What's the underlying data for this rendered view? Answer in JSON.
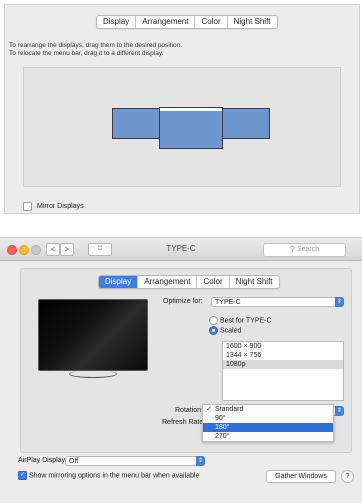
{
  "top_panel": {
    "tabs": [
      "Display",
      "Arrangement",
      "Color",
      "Night Shift"
    ],
    "help_line1": "To rearrange the displays, drag them to the desired position.",
    "help_line2": "To relocate the menu bar, drag it to a different display.",
    "mirror_label": "Mirror Displays",
    "mirror_checked": false
  },
  "window": {
    "title": "TYPE-C",
    "search_placeholder": "Search",
    "back_symbol": "<",
    "forward_symbol": ">",
    "grid_symbol": "⁞⁞⁞",
    "tabs": [
      "Display",
      "Arrangement",
      "Color",
      "Night Shift"
    ],
    "selected_tab": "Display",
    "optimize_label": "Optimize for:",
    "optimize_value": "TYPE-C",
    "best_for_label": "Best for TYPE-C",
    "scaled_label": "Scaled",
    "resolutions": [
      "1600 × 900",
      "1344 × 756",
      "1080p"
    ],
    "selected_resolution": "1080p",
    "rotation_label": "Rotation",
    "refresh_label": "Refresh Rate",
    "rotation_options": [
      "Standard",
      "90°",
      "180°",
      "270°"
    ],
    "rotation_checked": "Standard",
    "rotation_highlighted": "180°",
    "airplay_label": "AirPlay Display:",
    "airplay_value": "Off",
    "mirroring_option_label": "Show mirroring options in the menu bar when available",
    "mirroring_option_checked": true,
    "gather_label": "Gather Windows",
    "help_label": "?"
  },
  "colors": {
    "accent": "#3f7ee8",
    "display_fill": "#6e97cf",
    "close": "#fd5f57",
    "minimize": "#febc2e",
    "zoom": "#c8c8c8"
  }
}
